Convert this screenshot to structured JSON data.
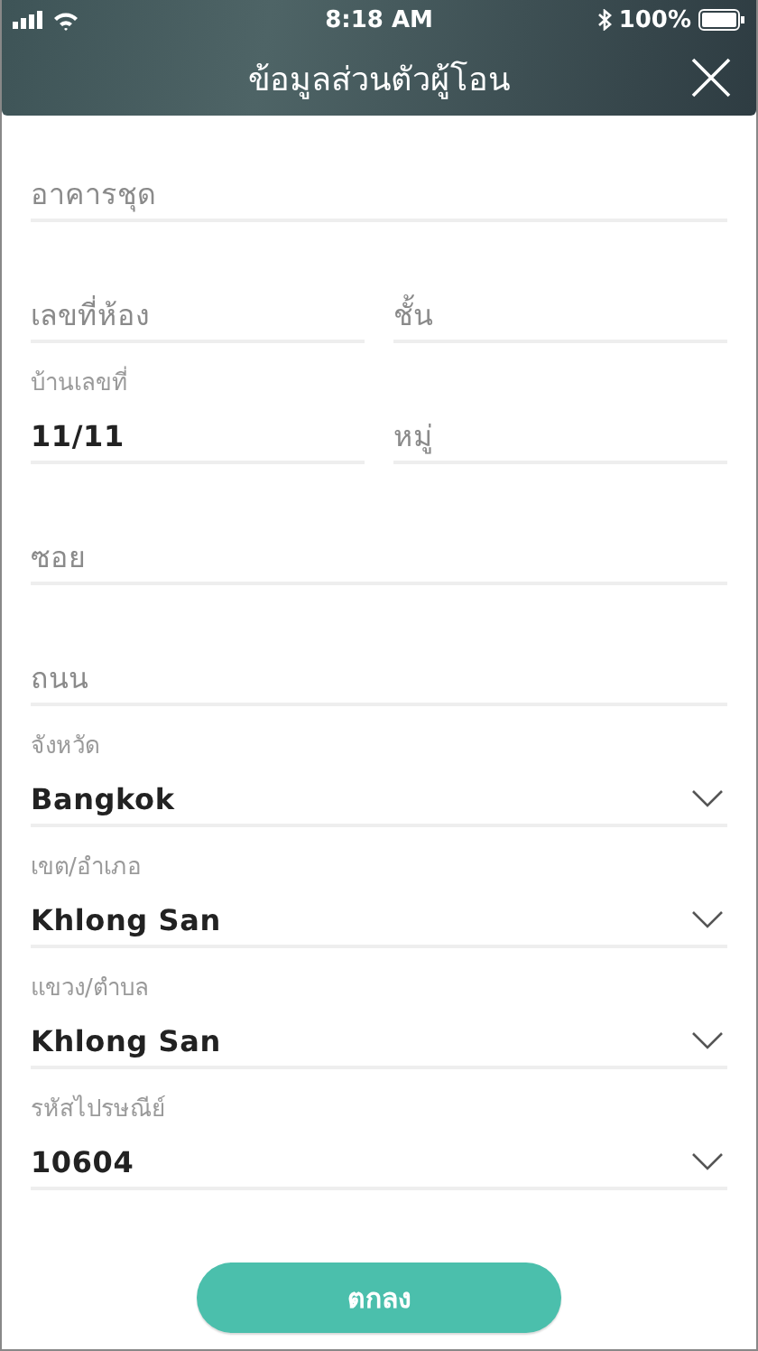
{
  "status_bar": {
    "time": "8:18 AM",
    "battery": "100%"
  },
  "header": {
    "title": "ข้อมูลส่วนตัวผู้โอน"
  },
  "form_rows": [
    [
      {
        "kind": "text",
        "placeholder": "อาคารชุด"
      }
    ],
    [
      {
        "kind": "text",
        "placeholder": "เลขที่ห้อง"
      },
      {
        "kind": "text",
        "placeholder": "ชั้น"
      }
    ],
    [
      {
        "kind": "text",
        "label": "บ้านเลขที่",
        "value": "11/11"
      },
      {
        "kind": "text",
        "placeholder": "หมู่"
      }
    ],
    [
      {
        "kind": "text",
        "placeholder": "ซอย"
      }
    ],
    [
      {
        "kind": "text",
        "placeholder": "ถนน"
      }
    ],
    [
      {
        "kind": "select",
        "label": "จังหวัด",
        "value": "Bangkok"
      }
    ],
    [
      {
        "kind": "select",
        "label": "เขต/อำเภอ",
        "value": "Khlong San"
      }
    ],
    [
      {
        "kind": "select",
        "label": "แขวง/ตำบล",
        "value": "Khlong San"
      }
    ],
    [
      {
        "kind": "select",
        "label": "รหัสไปรษณีย์",
        "value": "10604"
      }
    ]
  ],
  "submit_button": "ตกลง"
}
